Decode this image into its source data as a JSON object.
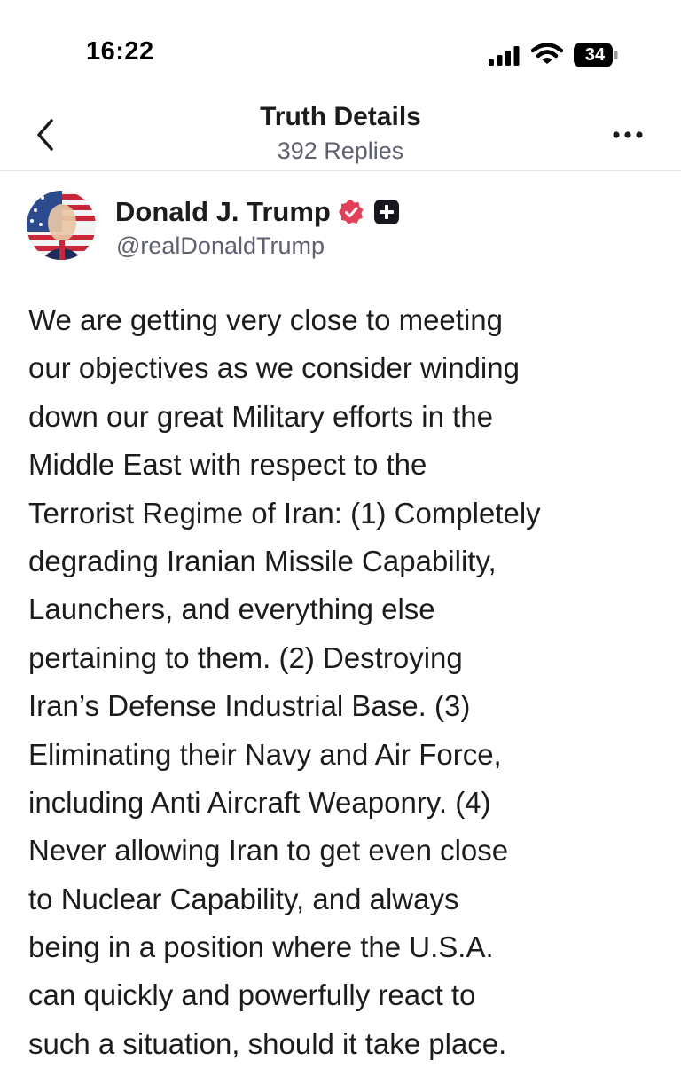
{
  "status_bar": {
    "time": "16:22",
    "battery": "34",
    "icons": [
      "signal-icon",
      "wifi-icon",
      "battery-icon"
    ]
  },
  "header": {
    "back_icon": "chevron-left-icon",
    "title": "Truth Details",
    "subtitle": "392 Replies",
    "more_icon": "ellipsis-icon"
  },
  "post": {
    "author": {
      "name": "Donald J. Trump",
      "handle": "@realDonaldTrump",
      "verified_icon": "verified-badge-icon",
      "badge_icon": "plus-badge-icon",
      "verified_color": "#e0405a"
    },
    "lines": [
      "We are getting very close to meeting",
      "our objectives as we consider winding",
      "down our great Military efforts in the",
      "Middle East with respect to the",
      "Terrorist Regime of Iran: (1) Completely",
      "degrading Iranian Missile Capability,",
      "Launchers, and everything else",
      "pertaining to them. (2) Destroying",
      "Iran’s Defense Industrial Base. (3)",
      "Eliminating their Navy and Air Force,",
      "including Anti Aircraft Weaponry. (4)",
      "Never allowing Iran to get even close",
      "to Nuclear Capability, and always",
      "being in a position where the U.S.A.",
      "can quickly and powerfully react to",
      "such a situation, should it take place."
    ]
  }
}
